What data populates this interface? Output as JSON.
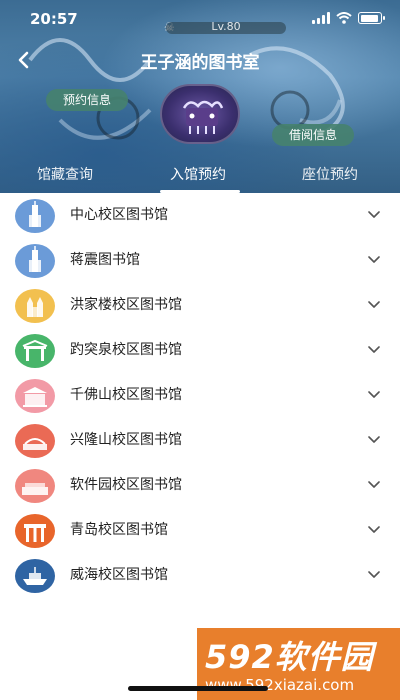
{
  "status_bar": {
    "time": "20:57",
    "battery_level": 0.9
  },
  "header": {
    "level": "Lv.80",
    "title": "王子涵的图书室",
    "reserve_info": "预约信息",
    "borrow_info": "借阅信息"
  },
  "tabs": [
    {
      "label": "馆藏查询",
      "active": false
    },
    {
      "label": "入馆预约",
      "active": true
    },
    {
      "label": "座位预约",
      "active": false
    }
  ],
  "libraries": [
    {
      "name": "中心校区图书馆",
      "icon": "tower-building-icon",
      "color": "#6b9bd8"
    },
    {
      "name": "蒋震图书馆",
      "icon": "tower-building-icon",
      "color": "#6b9bd8"
    },
    {
      "name": "洪家楼校区图书馆",
      "icon": "church-icon",
      "color": "#f2c04f"
    },
    {
      "name": "趵突泉校区图书馆",
      "icon": "gate-icon",
      "color": "#48b56a"
    },
    {
      "name": "千佛山校区图书馆",
      "icon": "hall-icon",
      "color": "#f29aa6"
    },
    {
      "name": "兴隆山校区图书馆",
      "icon": "bridge-icon",
      "color": "#ea6a55"
    },
    {
      "name": "软件园校区图书馆",
      "icon": "long-building-icon",
      "color": "#f0877f"
    },
    {
      "name": "青岛校区图书馆",
      "icon": "gateway-icon",
      "color": "#e8652b"
    },
    {
      "name": "威海校区图书馆",
      "icon": "ship-icon",
      "color": "#2f64a3"
    }
  ],
  "watermark": {
    "logo": "592软件园",
    "url": "www.592xiazai.com"
  }
}
